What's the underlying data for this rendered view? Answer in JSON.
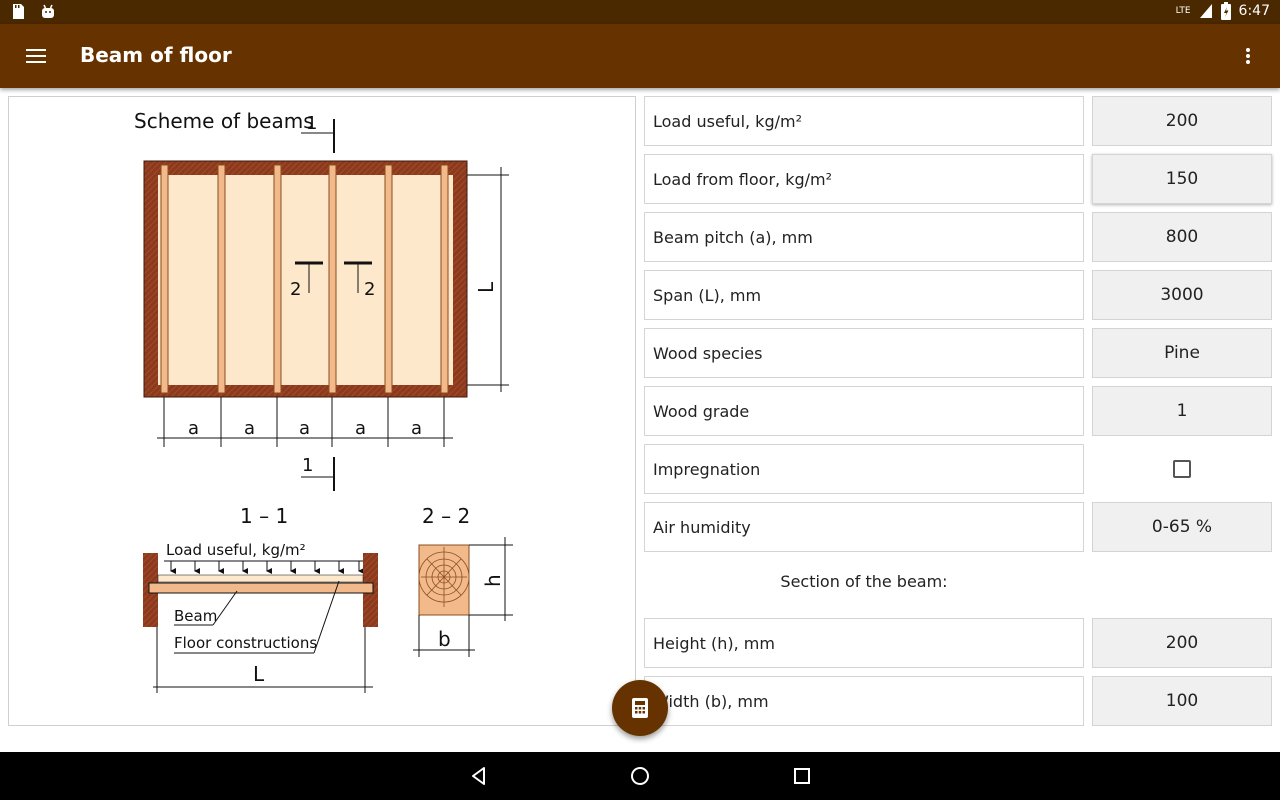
{
  "statusbar": {
    "time": "6:47",
    "network": "LTE",
    "icons": [
      "sd-card-icon",
      "android-icon",
      "signal-icon",
      "battery-icon"
    ]
  },
  "appbar": {
    "title": "Beam of floor",
    "color": "#663300",
    "status_color": "#4a2800"
  },
  "diagram": {
    "title": "Scheme of beams",
    "section_1_mark": "1",
    "section_2_mark": "2",
    "span_label": "L",
    "pitch_label": "a",
    "section_1_title": "1 – 1",
    "section_2_title": "2 – 2",
    "load_label": "Load useful, kg/m²",
    "beam_label": "Beam",
    "floor_label": "Floor constructions",
    "height_label": "h",
    "width_label": "b"
  },
  "form": {
    "rows": [
      {
        "label": "Load useful, kg/m²",
        "value": "200"
      },
      {
        "label": "Load from floor, kg/m²",
        "value": "150"
      },
      {
        "label": "Beam pitch (a), mm",
        "value": "800"
      },
      {
        "label": "Span (L), mm",
        "value": "3000"
      },
      {
        "label": "Wood species",
        "value": "Pine"
      },
      {
        "label": "Wood grade",
        "value": "1"
      },
      {
        "label": "Impregnation",
        "checked": false
      },
      {
        "label": "Air humidity",
        "value": "0-65 %"
      }
    ],
    "section_title": "Section of the beam:",
    "section_rows": [
      {
        "label": "Height (h), mm",
        "value": "200"
      },
      {
        "label": "Width (b), mm",
        "value": "100"
      }
    ]
  },
  "fab": {
    "icon": "calculator-icon"
  },
  "navbar": {
    "icons": [
      "back-icon",
      "home-icon",
      "recents-icon"
    ]
  }
}
